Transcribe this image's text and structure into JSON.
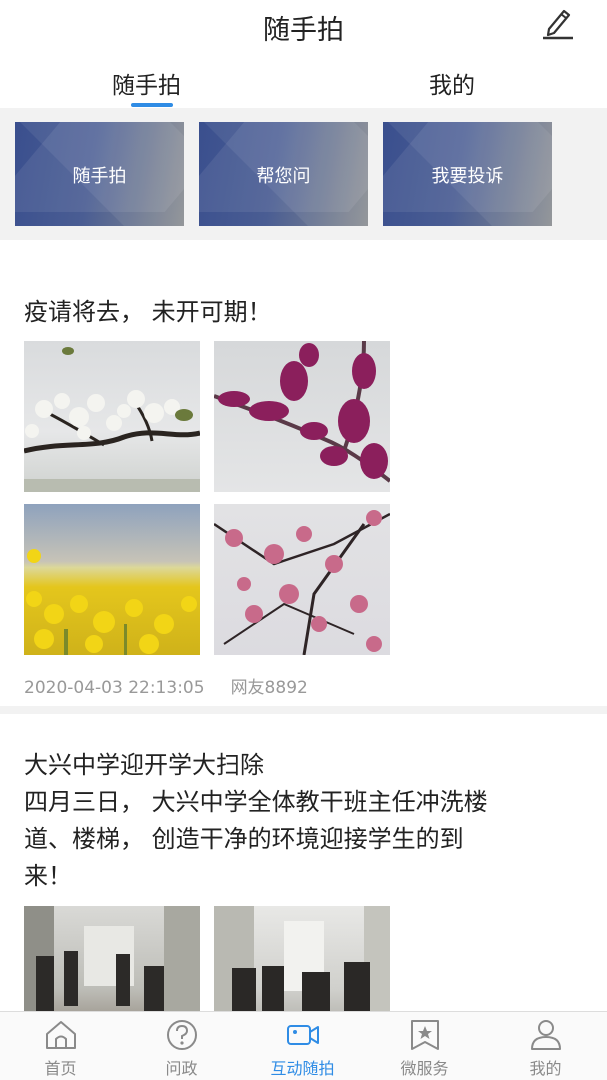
{
  "header": {
    "title": "随手拍",
    "edit_icon": "pencil-edit-icon"
  },
  "tabs": [
    {
      "label": "随手拍",
      "active": true
    },
    {
      "label": "我的",
      "active": false
    }
  ],
  "accent_color": "#2f8ce5",
  "banners": [
    {
      "label": "随手拍"
    },
    {
      "label": "帮您问"
    },
    {
      "label": "我要投诉"
    }
  ],
  "posts": [
    {
      "title": "疫请将去， 未开可期！",
      "timestamp": "2020-04-03 22:13:05",
      "author": "网友8892",
      "images": [
        "white-blossom-photo",
        "redbud-blossom-photo",
        "rapeseed-field-photo",
        "peach-blossom-photo"
      ]
    },
    {
      "title": "大兴中学迎开学大扫除",
      "desc_lines": [
        "四月三日， 大兴中学全体教干班主任冲洗楼",
        "道、楼梯， 创造干净的环境迎接学生的到",
        "来！"
      ],
      "images": [
        "hallway-cleaning-photo-1",
        "hallway-cleaning-photo-2"
      ]
    }
  ],
  "bottom_nav": [
    {
      "label": "首页",
      "icon": "home-icon",
      "active": false
    },
    {
      "label": "问政",
      "icon": "question-icon",
      "active": false
    },
    {
      "label": "互动随拍",
      "icon": "video-camera-icon",
      "active": true
    },
    {
      "label": "微服务",
      "icon": "star-bookmark-icon",
      "active": false
    },
    {
      "label": "我的",
      "icon": "user-icon",
      "active": false
    }
  ]
}
